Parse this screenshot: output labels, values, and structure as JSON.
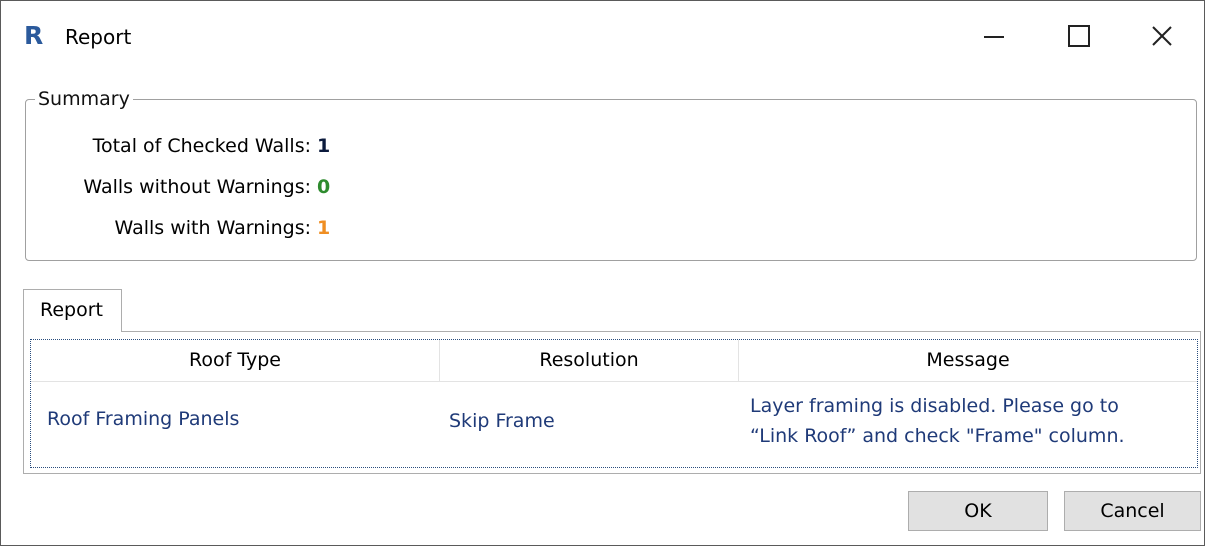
{
  "window": {
    "title": "Report",
    "app_icon_letter": "R"
  },
  "summary": {
    "legend": "Summary",
    "total_label": "Total of Checked Walls:",
    "total_value": "1",
    "without_warnings_label": "Walls without Warnings:",
    "without_warnings_value": "0",
    "with_warnings_label": "Walls with Warnings:",
    "with_warnings_value": "1",
    "colors": {
      "total": "#0b1a3c",
      "without_warnings": "#2e8b2e",
      "with_warnings": "#ef8e22"
    }
  },
  "tabs": [
    {
      "label": "Report"
    }
  ],
  "table": {
    "columns": [
      "Roof Type",
      "Resolution",
      "Message"
    ],
    "rows": [
      {
        "roof_type": "Roof Framing Panels",
        "resolution": "Skip Frame",
        "message_line1": "Layer framing is disabled. Please go to",
        "message_line2": "“Link Roof” and check \"Frame\" column."
      }
    ]
  },
  "buttons": {
    "ok": "OK",
    "cancel": "Cancel"
  }
}
